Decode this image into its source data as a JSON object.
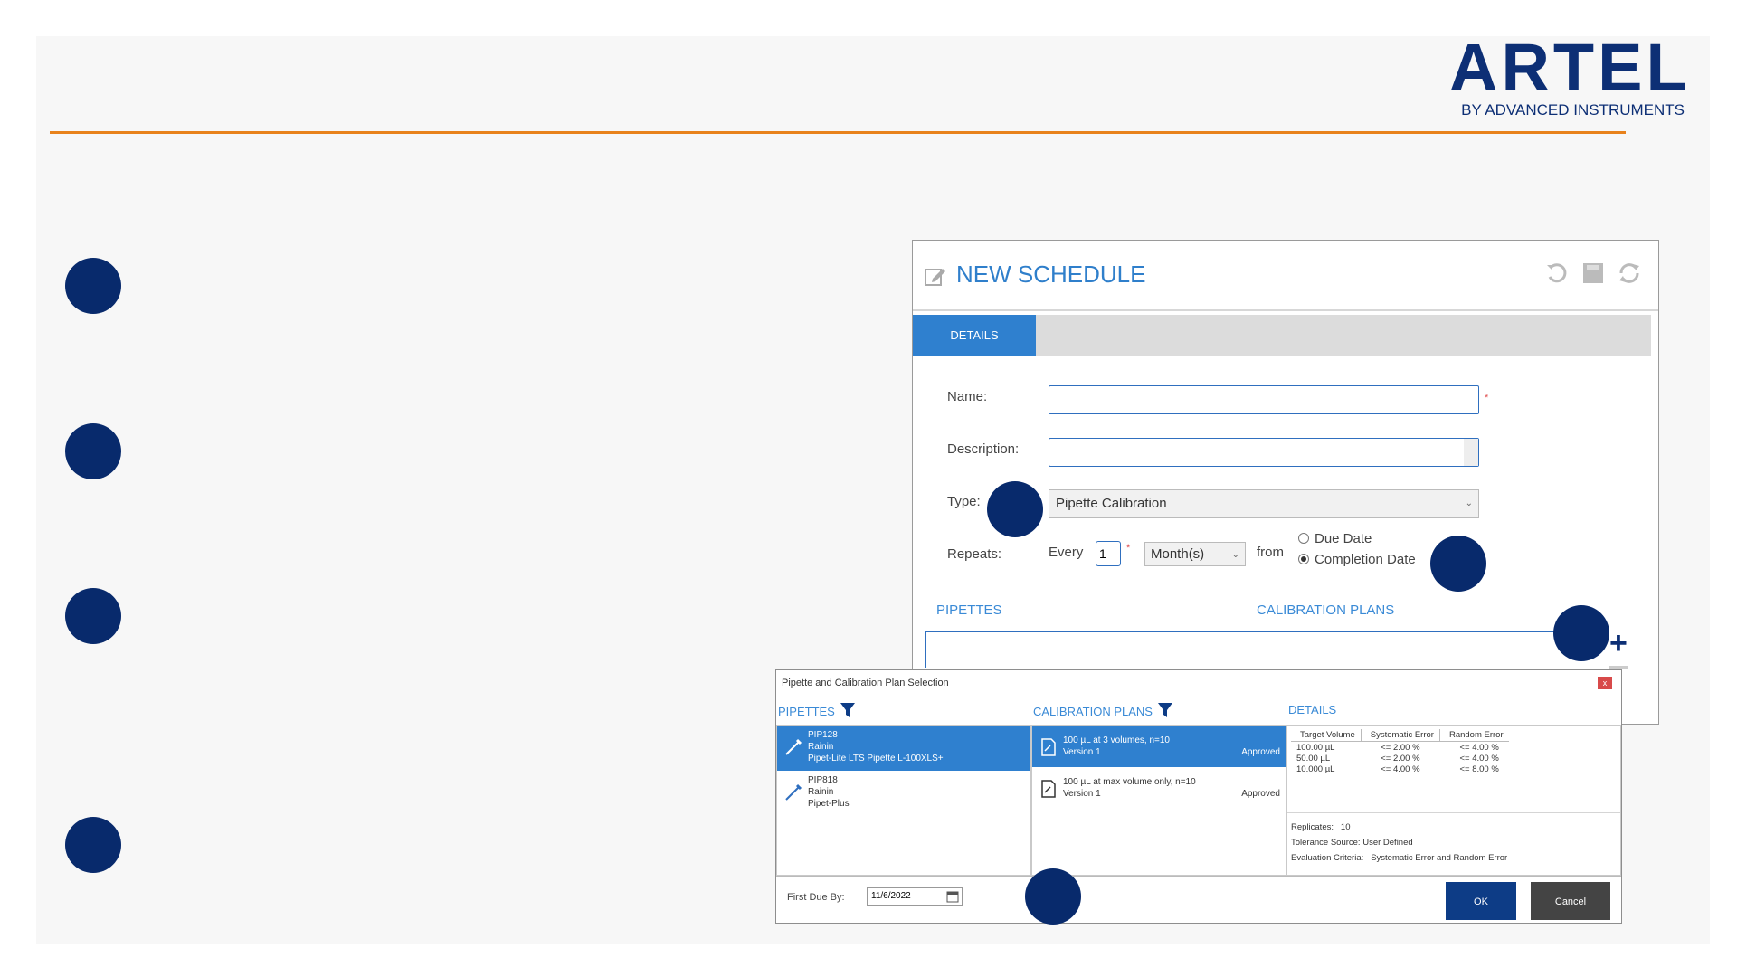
{
  "logo": {
    "name": "ARTEL",
    "tagline": "BY ADVANCED INSTRUMENTS"
  },
  "colors": {
    "accent_orange": "#e8821c",
    "navy": "#082a6c",
    "blue": "#2f80cf"
  },
  "app": {
    "title": "NEW SCHEDULE",
    "icons": [
      "edit-icon",
      "undo-icon",
      "save-icon",
      "refresh-icon"
    ],
    "tab": "DETAILS",
    "form": {
      "name_label": "Name:",
      "name_value": "",
      "description_label": "Description:",
      "description_value": "",
      "type_label": "Type:",
      "type_value": "Pipette Calibration",
      "repeats_label": "Repeats:",
      "every_label": "Every",
      "every_value": "1",
      "period_value": "Month(s)",
      "from_label": "from",
      "radio_due": "Due Date",
      "radio_completion": "Completion Date",
      "selected_radio": "Completion Date",
      "required_mark": "*"
    },
    "sections": {
      "pipettes": "PIPETTES",
      "plans": "CALIBRATION PLANS"
    }
  },
  "dialog": {
    "title": "Pipette and Calibration Plan Selection",
    "close": "x",
    "pipettes_header": "PIPETTES",
    "plans_header": "CALIBRATION PLANS",
    "details_header": "DETAILS",
    "pipettes": [
      {
        "id": "PIP128",
        "maker": "Rainin",
        "model": "Pipet-Lite LTS Pipette L-100XLS+",
        "selected": true
      },
      {
        "id": "PIP818",
        "maker": "Rainin",
        "model": "Pipet-Plus",
        "selected": false
      }
    ],
    "plans": [
      {
        "name": "100 µL at 3 volumes, n=10",
        "version": "Version 1",
        "status": "Approved",
        "selected": true
      },
      {
        "name": "100 µL at max volume only, n=10",
        "version": "Version 1",
        "status": "Approved",
        "selected": false
      }
    ],
    "details_columns": [
      "Target Volume",
      "Systematic Error",
      "Random Error"
    ],
    "details_rows": [
      [
        "100.00 µL",
        "<= 2.00 %",
        "<= 4.00 %"
      ],
      [
        "50.00 µL",
        "<= 2.00 %",
        "<= 4.00 %"
      ],
      [
        "10.000 µL",
        "<= 4.00 %",
        "<= 8.00 %"
      ]
    ],
    "replicates_label": "Replicates:",
    "replicates_value": "10",
    "tolerance_label": "Tolerance Source:",
    "tolerance_value": "User Defined",
    "criteria_label": "Evaluation Criteria:",
    "criteria_value": "Systematic Error and Random Error",
    "first_due_label": "First Due By:",
    "first_due_value": "11/6/2022",
    "ok": "OK",
    "cancel": "Cancel"
  }
}
